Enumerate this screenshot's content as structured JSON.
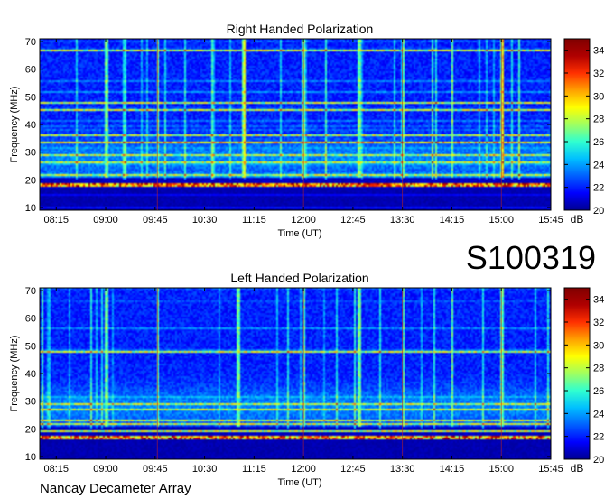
{
  "page": {
    "station_id": "S100319",
    "instrument": "Nancay Decameter Array"
  },
  "colorbar": {
    "unit": "dB",
    "ticks": [
      20,
      22,
      24,
      26,
      28,
      30,
      32,
      34
    ],
    "stops": [
      "#00008f",
      "#0000ff",
      "#0060ff",
      "#00c0ff",
      "#30ffd0",
      "#a0ff60",
      "#ffff00",
      "#ffa000",
      "#ff3000",
      "#b00000",
      "#800000"
    ]
  },
  "chart_data": [
    {
      "type": "heatmap",
      "title": "Right Handed Polarization",
      "xlabel": "Time (UT)",
      "ylabel": "Frequency (MHz)",
      "x_ticks": [
        "08:15",
        "09:00",
        "09:45",
        "10:30",
        "11:15",
        "12:00",
        "12:45",
        "13:30",
        "14:15",
        "15:00",
        "15:45"
      ],
      "y_ticks": [
        10,
        20,
        30,
        40,
        50,
        60,
        70
      ],
      "xlim": [
        "08:00",
        "15:45"
      ],
      "ylim": [
        9,
        71
      ],
      "zlim": [
        20,
        35
      ],
      "z_unit": "dB",
      "background_level": 22,
      "features": {
        "low_band": [
          17,
          21
        ],
        "bright_horizontal_lines_mhz": [
          22,
          26.5,
          29,
          33.5,
          36,
          45,
          48,
          67
        ],
        "vertical_interference_times": [
          "09:00",
          "09:47",
          "11:05",
          "12:00",
          "12:50",
          "13:30",
          "14:15",
          "15:00"
        ]
      }
    },
    {
      "type": "heatmap",
      "title": "Left Handed Polarization",
      "xlabel": "Time (UT)",
      "ylabel": "Frequency (MHz)",
      "x_ticks": [
        "08:15",
        "09:00",
        "09:45",
        "10:30",
        "11:15",
        "12:00",
        "12:45",
        "13:30",
        "14:15",
        "15:00",
        "15:45"
      ],
      "y_ticks": [
        10,
        20,
        30,
        40,
        50,
        60,
        70
      ],
      "xlim": [
        "08:00",
        "15:45"
      ],
      "ylim": [
        9,
        71
      ],
      "zlim": [
        20,
        35
      ],
      "z_unit": "dB",
      "background_level": 22,
      "features": {
        "low_band": [
          16,
          21
        ],
        "bright_horizontal_lines_mhz": [
          19,
          22,
          23,
          27,
          29,
          48
        ],
        "vertical_interference_times": [
          "09:00",
          "09:47",
          "11:00",
          "12:00",
          "12:50",
          "13:30",
          "14:15",
          "15:00"
        ]
      }
    }
  ]
}
